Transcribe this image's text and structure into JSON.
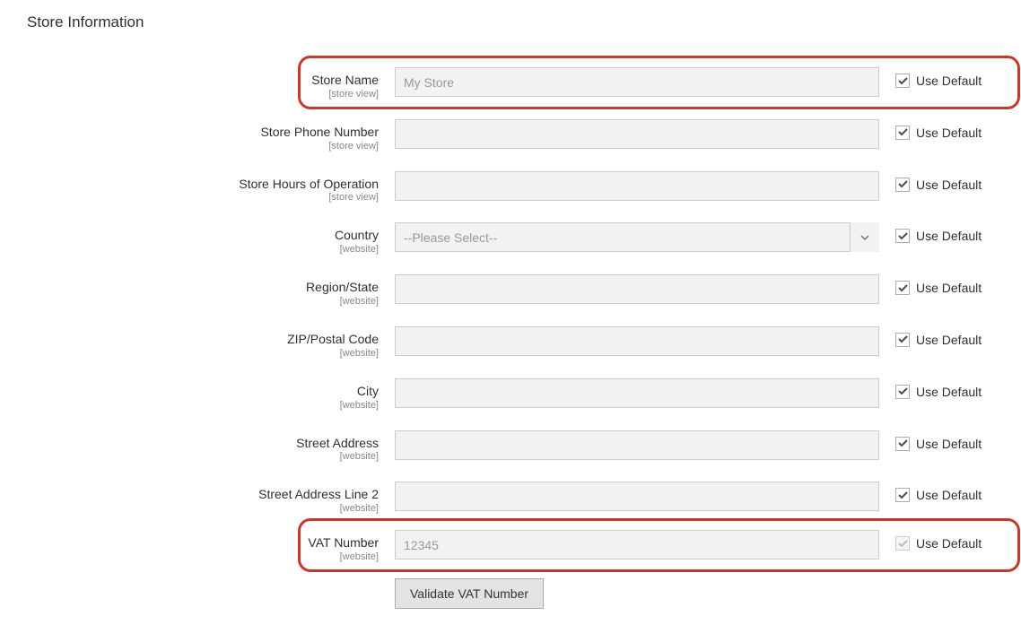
{
  "section_title": "Store Information",
  "use_default_label": "Use Default",
  "fields": {
    "store_name": {
      "label": "Store Name",
      "scope": "[store view]",
      "value": "My Store",
      "checkbox_disabled": false
    },
    "store_phone": {
      "label": "Store Phone Number",
      "scope": "[store view]",
      "value": "",
      "checkbox_disabled": false
    },
    "store_hours": {
      "label": "Store Hours of Operation",
      "scope": "[store view]",
      "value": "",
      "checkbox_disabled": false
    },
    "country": {
      "label": "Country",
      "scope": "[website]",
      "selected": "--Please Select--",
      "checkbox_disabled": false
    },
    "region": {
      "label": "Region/State",
      "scope": "[website]",
      "value": "",
      "checkbox_disabled": false
    },
    "zip": {
      "label": "ZIP/Postal Code",
      "scope": "[website]",
      "value": "",
      "checkbox_disabled": false
    },
    "city": {
      "label": "City",
      "scope": "[website]",
      "value": "",
      "checkbox_disabled": false
    },
    "street1": {
      "label": "Street Address",
      "scope": "[website]",
      "value": "",
      "checkbox_disabled": false
    },
    "street2": {
      "label": "Street Address Line 2",
      "scope": "[website]",
      "value": "",
      "checkbox_disabled": false
    },
    "vat": {
      "label": "VAT Number",
      "scope": "[website]",
      "value": "12345",
      "checkbox_disabled": true
    }
  },
  "validate_button": "Validate VAT Number"
}
